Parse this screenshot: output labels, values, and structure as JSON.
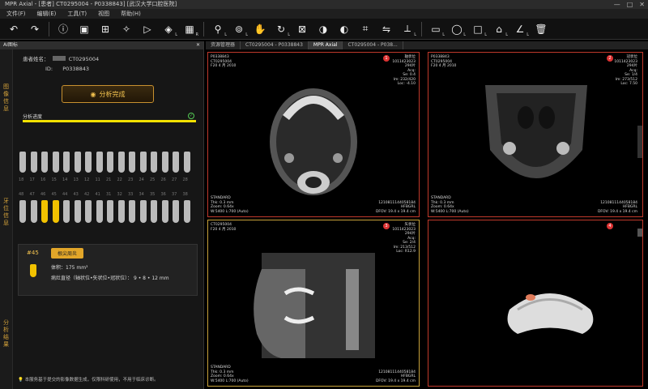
{
  "window": {
    "title": "MPR Axial - [患者] CT0295004 - P0338843] [武汉大学口腔医院]",
    "controls": [
      "—",
      "□",
      "✕"
    ]
  },
  "menu": [
    "文件(F)",
    "编辑(E)",
    "工具(T)",
    "视图",
    "帮助(H)"
  ],
  "toolbar": {
    "icons": [
      "undo-icon",
      "redo-icon",
      "info-icon",
      "ai-icon",
      "grid-icon",
      "wand-icon",
      "play-icon",
      "layers-icon",
      "layout-icon",
      "zoom-icon",
      "zoom-fit-icon",
      "pan-icon",
      "rotate-icon",
      "ruler-icon",
      "window-level-icon",
      "contrast-icon",
      "crop-icon",
      "mirror-icon",
      "measure-icon",
      "ellipse-icon",
      "rect-icon",
      "polygon-icon",
      "angle-icon",
      "delete-icon"
    ]
  },
  "left": {
    "panel_title": "AI图标",
    "tabs": [
      "图像信息",
      "牙位信息",
      "分析结果"
    ],
    "patient_label": "患者姓名：",
    "patient_name": "CT0295004",
    "id_label": "ID:",
    "id_value": "P0338843",
    "analyze_label": "分析完成",
    "progress_label": "分析进度",
    "progress": 1.0,
    "upper_numbers": [
      "18",
      "17",
      "16",
      "15",
      "14",
      "13",
      "12",
      "11",
      "21",
      "22",
      "23",
      "24",
      "25",
      "26",
      "27",
      "28"
    ],
    "lower_numbers": [
      "48",
      "47",
      "46",
      "45",
      "44",
      "43",
      "42",
      "41",
      "31",
      "32",
      "33",
      "34",
      "35",
      "36",
      "37",
      "38"
    ],
    "selected_teeth": [
      "46",
      "45"
    ],
    "result": {
      "tooth": "#45",
      "tag": "根尖周炎",
      "row1": "体积：175 mm³",
      "row2": "病灶直径（轴状位•矢状位•冠状位）： 9 • 8 • 12 mm"
    },
    "footnote": "本服务基于提交的影像数据生成，仅限科研使用，不用于临床诊断。"
  },
  "viewer": {
    "tabs": [
      "资源管理器",
      "CT0295004 - P0338843",
      "MPR Axial",
      "CT0295004 - P038..."
    ],
    "viewports": [
      {
        "num": "1",
        "tl": "P0338843\nCT0295004\nF20 4 月 2010",
        "tr": "轴状位\n1011423023\n294片\nAcq:\nSe: 0.4\nIm: 232/420\nLoc: -4.10",
        "bl": "STANDARD\nThk: 0.3 mm\nZoom: 0.64x\nW:5400 L:700 (Auto)",
        "br": "1210811144058184\nHFBGRL\nDFOV: 19.4 x 19.4 cm"
      },
      {
        "num": "2",
        "tl": "P0338843\nCT0295004\nF20 4 月 2010",
        "tr": "冠状位\n1011423023\n294片\nAcq:\nSe: 1/4\nIm: 273/512\nLoc: 7.50",
        "bl": "STANDARD\nThk: 0.3 mm\nZoom: 0.64x\nW:5400 L:700 (Auto)",
        "br": "1210811144058184\nHFBGRL\nDFOV: 19.4 x 19.4 cm"
      },
      {
        "num": "3",
        "tl": "CT0295004\nF20 4 月 2010",
        "tr": "矢状位\n1011423023\n294片\nAcq:\nSe: 2/4\nIm: 213/512\nLoc: R12.9",
        "bl": "STANDARD\nThk: 0.3 mm\nZoom: 0.64x\nW:5400 L:700 (Auto)",
        "br": "1210811144058184\nHFBGRL\nDFOV: 19.4 x 19.4 cm"
      },
      {
        "num": "4"
      }
    ]
  },
  "colors": {
    "accent": "#f2c24f",
    "viewport_border": "#c0392b",
    "selected_border": "#c8a23a"
  }
}
